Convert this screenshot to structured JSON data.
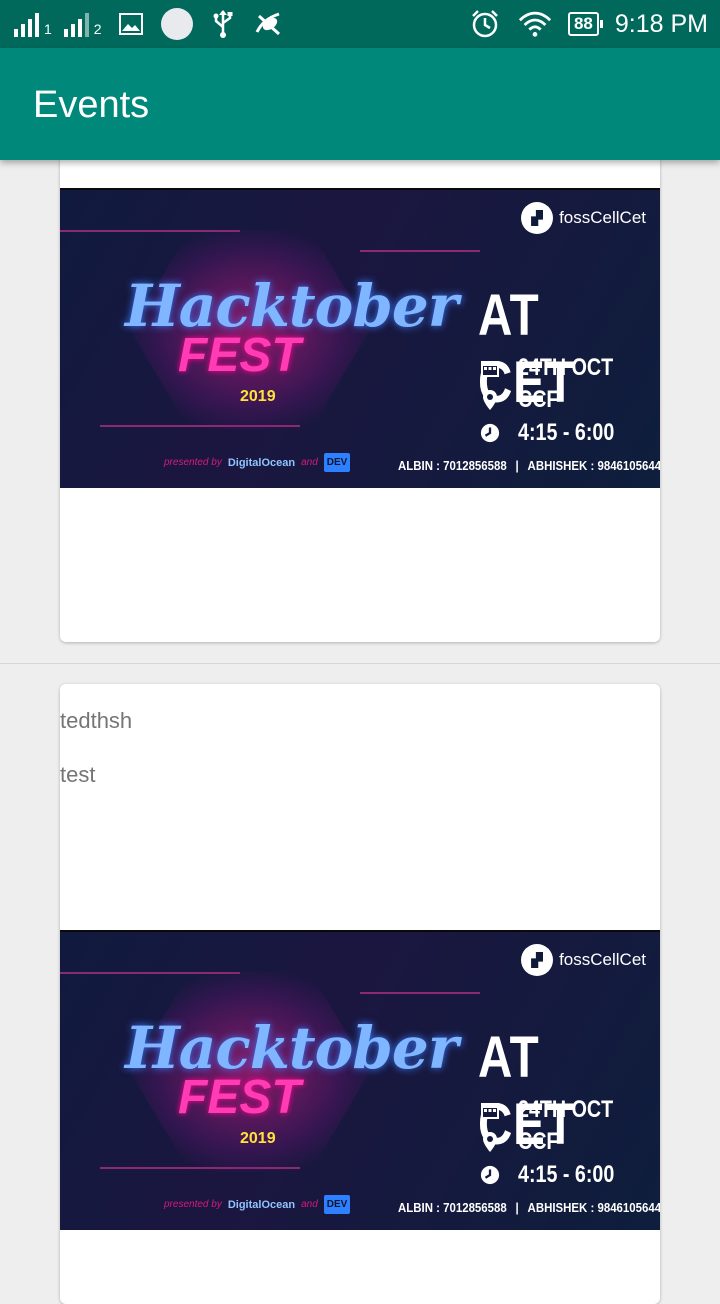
{
  "status_bar": {
    "sim1": "1",
    "sim2": "2",
    "battery": "88",
    "time": "9:18 PM"
  },
  "app_bar": {
    "title": "Events"
  },
  "posters": {
    "brand": "fossCellCet",
    "title_line1": "Hacktober",
    "title_line2": "FEST",
    "year": "2019",
    "presented_by": "presented by",
    "sponsor1": "DigitalOcean",
    "and": "and",
    "sponsor2": "DEV",
    "headline": "AT CET",
    "date": "24TH OCT",
    "venue": "CCF",
    "time": "4:15 - 6:00",
    "contact1": "ALBIN : 7012856588",
    "separator": "|",
    "contact2": "ABHISHEK : 9846105644"
  },
  "events": [
    {
      "title": "",
      "description": ""
    },
    {
      "title": "tedthsh",
      "description": "test"
    }
  ],
  "colors": {
    "status_bar": "#00695c",
    "app_bar": "#00897b",
    "background": "#eeeeee"
  }
}
